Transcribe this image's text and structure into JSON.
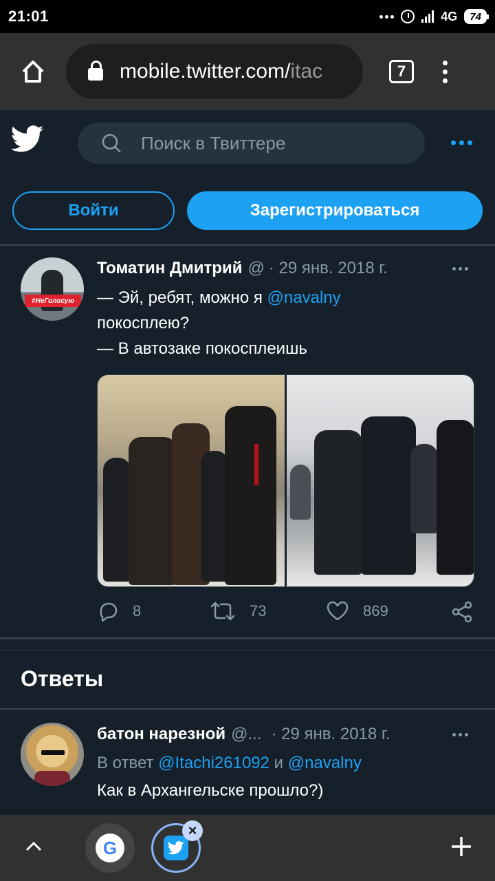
{
  "status_bar": {
    "time": "21:01",
    "network": "4G",
    "battery": "74"
  },
  "browser": {
    "url_main": "mobile.twitter.com/",
    "url_path": "itac",
    "tab_count": "7"
  },
  "header": {
    "search_placeholder": "Поиск в Твиттере"
  },
  "auth": {
    "login_label": "Войти",
    "signup_label": "Зарегистрироваться"
  },
  "tweet": {
    "name": "Томатин Дмитрий",
    "handle": "@",
    "date": "· 29 янв. 2018 г.",
    "line1_prefix": "— Эй, ребят, можно я ",
    "line1_mention": "@navalny",
    "line2": "покосплею?",
    "line3": "— В автозаке покосплеишь",
    "avatar_tag": "#НеГолосую",
    "replies": "8",
    "retweets": "73",
    "likes": "869"
  },
  "answers": {
    "title": "Ответы"
  },
  "reply": {
    "name": "батон нарезной",
    "handle": "@...",
    "date": "· 29 янв. 2018 г.",
    "in_reply_prefix": "В ответ ",
    "mention1": "@Itachi261092",
    "conj": " и ",
    "mention2": "@navalny",
    "text": "Как в Архангельске прошло?)"
  },
  "colors": {
    "background": "#15202b",
    "accent": "#1da1f2",
    "muted": "#8899a6"
  }
}
